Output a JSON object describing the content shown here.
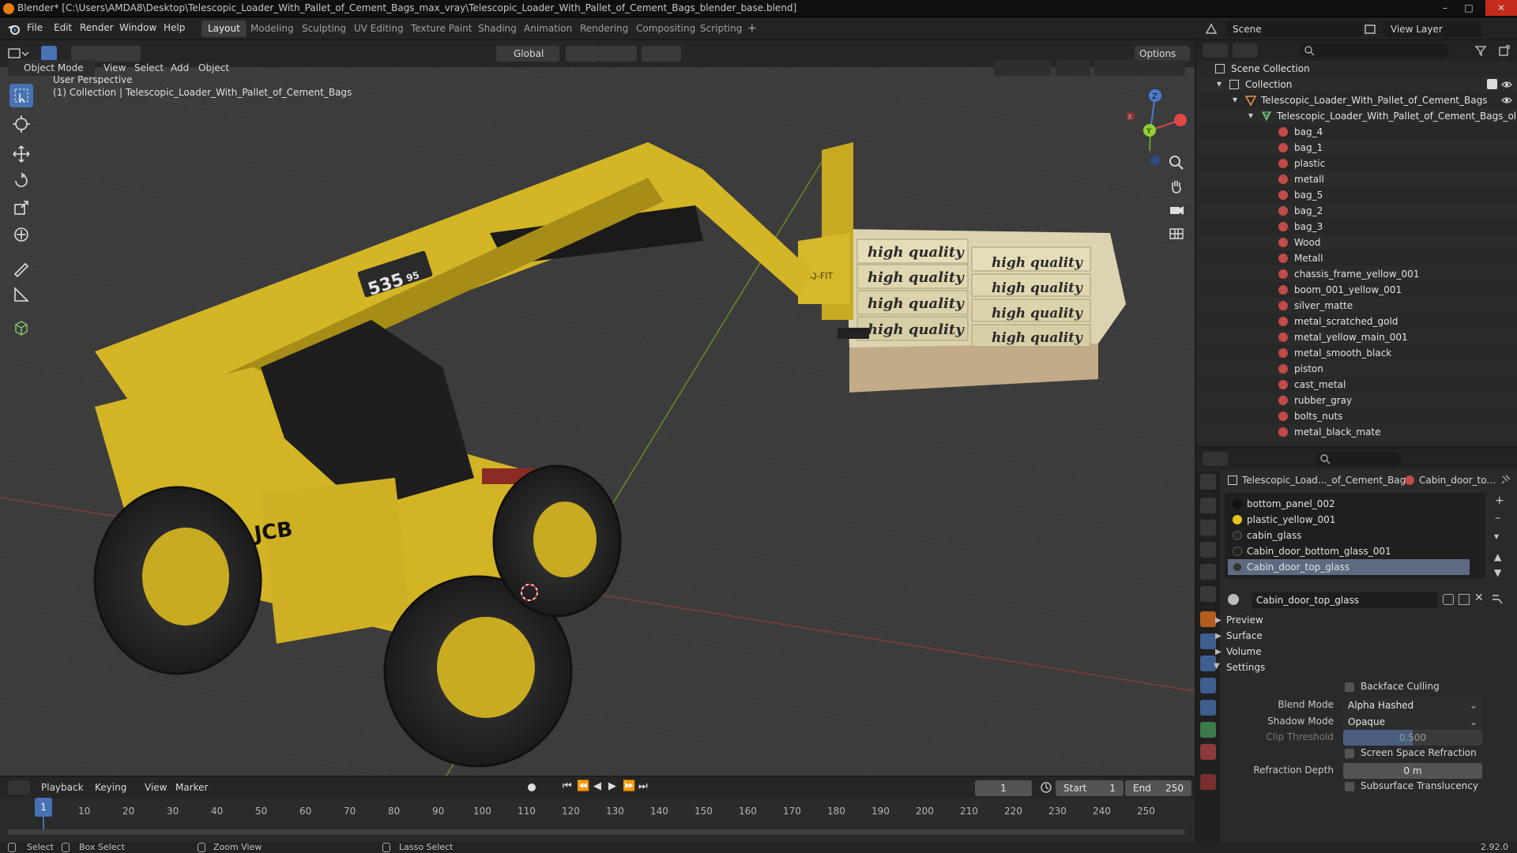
{
  "window": {
    "title": "Blender* [C:\\Users\\AMDA8\\Desktop\\Telescopic_Loader_With_Pallet_of_Cement_Bags_max_vray\\Telescopic_Loader_With_Pallet_of_Cement_Bags_blender_base.blend]"
  },
  "menubar": {
    "items": [
      "File",
      "Edit",
      "Render",
      "Window",
      "Help"
    ],
    "workspaces": [
      "Layout",
      "Modeling",
      "Sculpting",
      "UV Editing",
      "Texture Paint",
      "Shading",
      "Animation",
      "Rendering",
      "Compositing",
      "Scripting"
    ],
    "active_workspace": "Layout",
    "scene": "Scene",
    "view_layer": "View Layer"
  },
  "viewport_header": {
    "transform_orientation": "Global",
    "options": "Options",
    "mode": "Object Mode",
    "menus": [
      "View",
      "Select",
      "Add",
      "Object"
    ]
  },
  "viewport": {
    "perspective": "User Perspective",
    "collection_info": "(1) Collection | Telescopic_Loader_With_Pallet_of_Cement_Bags",
    "cab_badge": "535",
    "cab_badge_suffix": "95",
    "brand": "JCB",
    "bag_text": "high quality",
    "carriage_text": "Q-FIT",
    "gizmo": {
      "z": "Z",
      "y": "Y",
      "x": "X"
    }
  },
  "outliner": {
    "root": "Scene Collection",
    "collection": "Collection",
    "object": "Telescopic_Loader_With_Pallet_of_Cement_Bags",
    "mesh": "Telescopic_Loader_With_Pallet_of_Cement_Bags_ol",
    "materials": [
      "bag_4",
      "bag_1",
      "plastic",
      "metall",
      "bag_5",
      "bag_2",
      "bag_3",
      "Wood",
      "Metall",
      "chassis_frame_yellow_001",
      "boom_001_yellow_001",
      "silver_matte",
      "metal_scratched_gold",
      "metal_yellow_main_001",
      "metal_smooth_black",
      "piston",
      "cast_metal",
      "rubber_gray",
      "bolts_nuts",
      "metal_black_mate"
    ]
  },
  "properties": {
    "breadcrumb_object": "Telescopic_Load..._of_Cement_Bags",
    "breadcrumb_material": "Cabin_door_to...",
    "slots": [
      "bottom_panel_002",
      "plastic_yellow_001",
      "cabin_glass",
      "Cabin_door_bottom_glass_001",
      "Cabin_door_top_glass"
    ],
    "selected_slot": "Cabin_door_top_glass",
    "material_name": "Cabin_door_top_glass",
    "panels": [
      "Preview",
      "Surface",
      "Volume",
      "Settings"
    ],
    "settings": {
      "backface_culling": "Backface Culling",
      "blend_mode_label": "Blend Mode",
      "blend_mode": "Alpha Hashed",
      "shadow_mode_label": "Shadow Mode",
      "shadow_mode": "Opaque",
      "clip_threshold_label": "Clip Threshold",
      "clip_threshold": "0.500",
      "screen_space_refraction": "Screen Space Refraction",
      "refraction_depth_label": "Refraction Depth",
      "refraction_depth": "0 m",
      "subsurface_translucency": "Subsurface Translucency"
    }
  },
  "timeline": {
    "menus": [
      "Playback",
      "Keying",
      "View",
      "Marker"
    ],
    "current_frame": "1",
    "start_label": "Start",
    "start": "1",
    "end_label": "End",
    "end": "250",
    "ruler": [
      "1",
      "10",
      "20",
      "30",
      "40",
      "50",
      "60",
      "70",
      "80",
      "90",
      "100",
      "110",
      "120",
      "130",
      "140",
      "150",
      "160",
      "170",
      "180",
      "190",
      "200",
      "210",
      "220",
      "230",
      "240",
      "250"
    ]
  },
  "statusbar": {
    "select": "Select",
    "box_select": "Box Select",
    "zoom_view": "Zoom View",
    "lasso_select": "Lasso Select",
    "version": "2.92.0"
  }
}
